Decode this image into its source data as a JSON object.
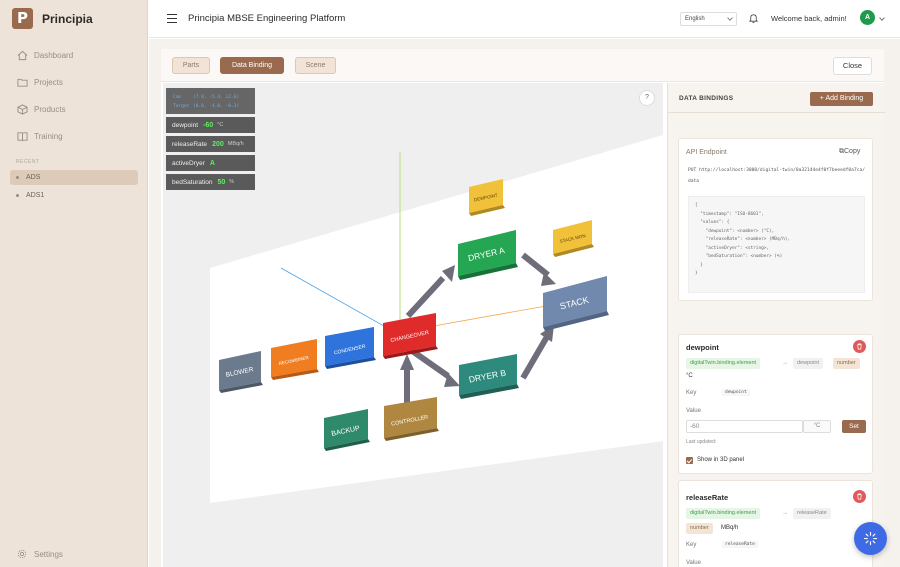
{
  "app": {
    "logo_letter": "P",
    "name": "Principia"
  },
  "sidebar": {
    "items": [
      {
        "label": "Dashboard",
        "icon": "home-icon"
      },
      {
        "label": "Projects",
        "icon": "folder-icon"
      },
      {
        "label": "Products",
        "icon": "cube-icon"
      },
      {
        "label": "Training",
        "icon": "book-icon"
      }
    ],
    "recent_label": "RECENT",
    "recent": [
      {
        "label": "ADS",
        "active": true
      },
      {
        "label": "ADS1",
        "active": false
      }
    ],
    "settings_label": "Settings"
  },
  "header": {
    "title": "Principia MBSE Engineering Platform",
    "language": "English",
    "welcome": "Welcome back, admin!",
    "avatar_letter": "A"
  },
  "toolbar": {
    "tabs": [
      {
        "label": "Parts",
        "active": false
      },
      {
        "label": "Data Binding",
        "active": true
      },
      {
        "label": "Scene",
        "active": false
      }
    ],
    "close_label": "Close"
  },
  "viewport": {
    "camera": {
      "cam_label": "Cam",
      "cam_value": "(7.0, -5.4, 12.6)",
      "target_label": "Target",
      "target_value": "(0.0, -4.0, -0.3)"
    },
    "hud_rows": [
      {
        "label": "dewpoint",
        "value": "-60",
        "unit": "°C"
      },
      {
        "label": "releaseRate",
        "value": "200",
        "unit": "MBq/h"
      },
      {
        "label": "activeDryer",
        "value": "A",
        "unit": ""
      },
      {
        "label": "bedSaturation",
        "value": "50",
        "unit": "%"
      }
    ],
    "help": "?",
    "blocks": {
      "blower": "BLOWER",
      "recombiner": "RECOMBINER",
      "condenser": "CONDENSER",
      "changeover": "CHANGEOVER",
      "dryer_a": "DRYER A",
      "dryer_b": "DRYER B",
      "stack": "STACK",
      "backup": "BACKUP",
      "controller": "CONTROLLER",
      "dewpoint": "DEWPOINT",
      "stack_mon": "STACK MON"
    }
  },
  "data_bindings": {
    "title": "DATA BINDINGS",
    "add_label": "+ Add Binding",
    "api": {
      "label": "API Endpoint",
      "copy_label": "Copy",
      "url": "PUT http://localhost:3000/digital-twin/0a32144e4f0f7beeedf0a7ca/data",
      "code": "{\n  \"timestamp\": \"ISO-8601\",\n  \"values\": {\n    \"dewpoint\": <number> (°C),\n    \"releaseRate\": <number> (MBq/h),\n    \"activeDryer\": <string>,\n    \"bedSaturation\": <number> (%)\n  }\n}"
    },
    "bindings": [
      {
        "title": "dewpoint",
        "source": "digitalTwin.binding.element",
        "arrow": "→",
        "target": "dewpoint",
        "type": "number",
        "unit": "°C",
        "key_label": "Key",
        "key": "dewpoint",
        "value_label": "Value",
        "value": "-60",
        "unit_box": "°C",
        "set_label": "Set",
        "last_updated": "Last updated:",
        "show_label": "Show in 3D panel"
      },
      {
        "title": "releaseRate",
        "source": "digitalTwin.binding.element",
        "arrow": "→",
        "target": "releaseRate",
        "type": "number",
        "unit": "MBq/h",
        "key_label": "Key",
        "key": "releaseRate",
        "value_label": "Value"
      }
    ]
  },
  "colors": {
    "accent": "#9a6a4f",
    "sidebar_bg": "#ede3d8",
    "fab": "#3f6ae6"
  }
}
